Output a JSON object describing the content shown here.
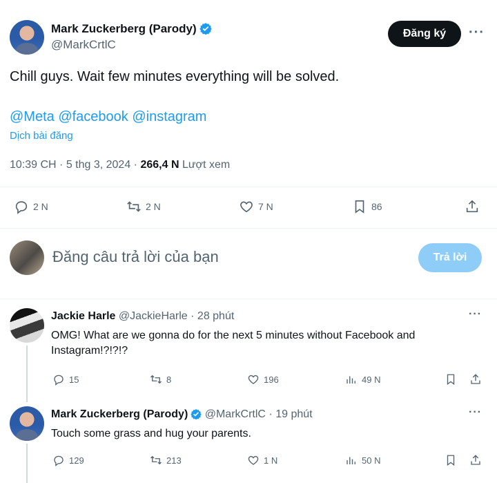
{
  "post": {
    "author_name": "Mark Zuckerberg (Parody)",
    "author_handle": "@MarkCrtlC",
    "follow_label": "Đăng ký",
    "text": "Chill guys. Wait few minutes everything will be solved.",
    "mentions": "@Meta @facebook @instagram",
    "translate_label": "Dịch bài đăng",
    "timestamp": "10:39 CH · 5 thg 3, 2024 · ",
    "views_count": "266,4 N",
    "views_label": " Lượt xem",
    "actions": {
      "replies": "2 N",
      "reposts": "2 N",
      "likes": "7 N",
      "bookmarks": "86"
    }
  },
  "composer": {
    "placeholder": "Đăng câu trả lời của bạn",
    "reply_button": "Trả lời"
  },
  "replies": [
    {
      "name": "Jackie Harle",
      "handle": "@JackieHarle",
      "time": "· 28 phút",
      "text": "OMG! What are we gonna do for the next 5 minutes without Facebook and Instagram!?!?!?",
      "replies": "15",
      "reposts": "8",
      "likes": "196",
      "views": "49 N"
    },
    {
      "name": "Mark Zuckerberg (Parody)",
      "handle": "@MarkCrtlC",
      "time": "· 19 phút",
      "text": "Touch some grass and hug your parents.",
      "replies": "129",
      "reposts": "213",
      "likes": "1 N",
      "views": "50 N"
    }
  ],
  "colors": {
    "accent": "#1d9bf0",
    "text": "#0f1419",
    "secondary": "#536471",
    "reply_button_disabled": "#8ecdf8"
  }
}
